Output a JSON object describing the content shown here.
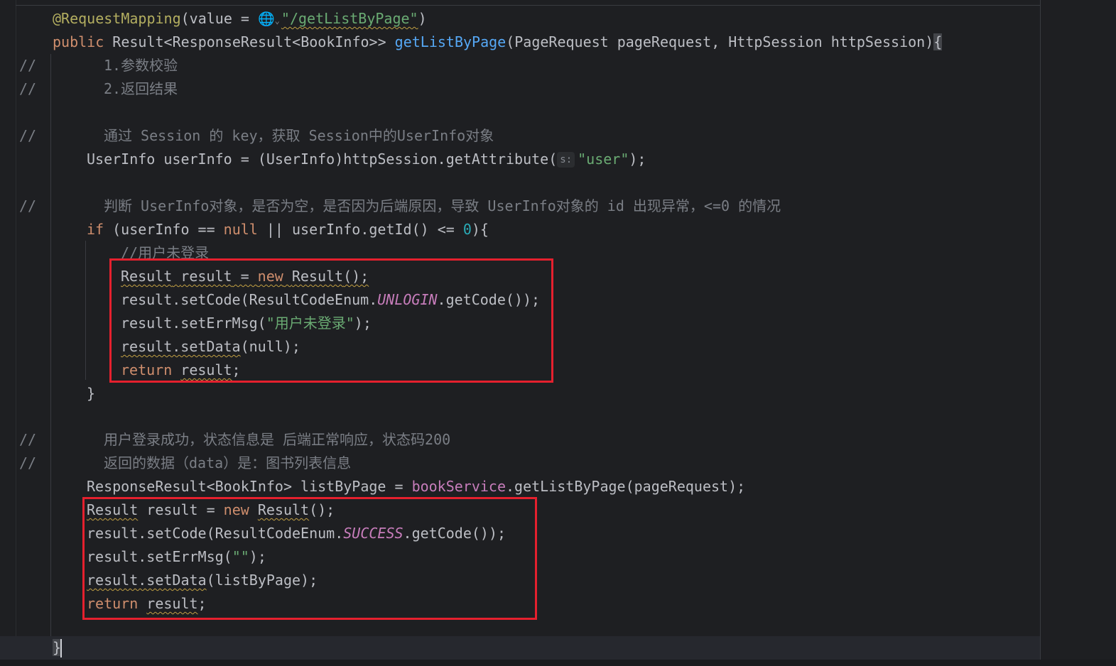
{
  "editor": {
    "gutter_comment_marks": [
      "//",
      "//",
      "//",
      "//",
      "//",
      "//"
    ],
    "lines": {
      "l1": {
        "annotation": "@RequestMapping",
        "open": "(value = ",
        "path": "\"/getListByPage\"",
        "close": ")"
      },
      "l2": {
        "kw": "public",
        "type": " Result<ResponseResult<BookInfo>> ",
        "method": "getListByPage",
        "params": "(PageRequest pageRequest, HttpSession httpSession)",
        "brace": "{"
      },
      "c1": "1.参数校验",
      "c2": "2.返回结果",
      "c3": "通过 Session 的 key，获取 Session中的UserInfo对象",
      "l3": {
        "pre": "UserInfo userInfo = (UserInfo)httpSession.getAttribute(",
        "hint": "s:",
        "str": "\"user\"",
        "post": ");"
      },
      "c4": "判断 UserInfo对象，是否为空，是否因为后端原因，导致 UserInfo对象的 id 出现异常，<=0 的情况",
      "l4": {
        "kw": "if",
        "a": " (userInfo == ",
        "nul": "null",
        "b": " || userInfo.getId() <= ",
        "num": "0",
        "c": "){"
      },
      "c5": "//用户未登录",
      "l5": {
        "t1": "Result",
        "t2": " ",
        "t3": "result",
        "t4": " = ",
        "kw": "new",
        "t5": " ",
        "t6": "Result",
        "t7": "();"
      },
      "l6": {
        "a": "result.setCode(ResultCodeEnum.",
        "enum": "UNLOGIN",
        "b": ".getCode());"
      },
      "l7": {
        "a": "result.setErrMsg(",
        "str": "\"用户未登录\"",
        "b": ");"
      },
      "l8": {
        "a": "result.setData",
        "b": "(null);"
      },
      "l9": {
        "kw": "return",
        "sp": " ",
        "v": "result",
        "e": ";"
      },
      "l10": "}",
      "c6": "用户登录成功，状态信息是 后端正常响应，状态码200",
      "c7": "返回的数据（data）是：图书列表信息",
      "l11": {
        "a": "ResponseResult<BookInfo> listByPage = ",
        "fld": "bookService",
        "b": ".getListByPage(pageRequest);"
      },
      "l12": {
        "t1": "Result",
        "t2": " result = ",
        "kw": "new",
        "t3": " ",
        "t4": "Result",
        "t5": "();"
      },
      "l13": {
        "a": "result.setCode(ResultCodeEnum.",
        "enum": "SUCCESS",
        "b": ".getCode());"
      },
      "l14": {
        "a": "result.setErrMsg(",
        "str": "\"\"",
        "b": ");"
      },
      "l15": {
        "a": "result.setData",
        "b": "(listByPage);"
      },
      "l16": {
        "kw": "return",
        "sp": " ",
        "v": "result",
        "e": ";"
      },
      "l17": "}"
    }
  },
  "colors": {
    "background": "#1e1f22",
    "highlight_box": "#e5202e",
    "keyword": "#cf8e6d",
    "string": "#6aab73",
    "method_decl": "#56a8f5",
    "comment": "#7a7e85"
  },
  "icons": [
    "globe-icon",
    "chevron-down-icon"
  ]
}
